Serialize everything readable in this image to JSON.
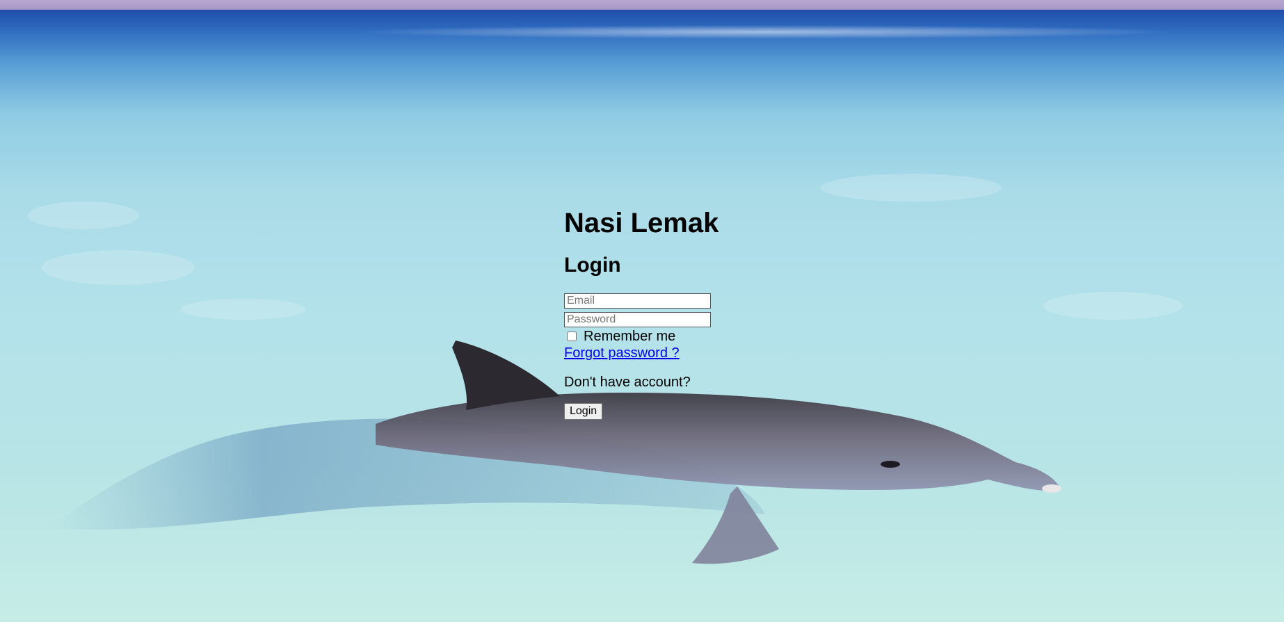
{
  "app": {
    "title": "Nasi Lemak"
  },
  "background": {
    "image": "dolphin-in-sea"
  },
  "login_form": {
    "heading": "Login",
    "email_placeholder": "Email",
    "password_placeholder": "Password",
    "remember_label": "Remember me",
    "remember_checked": false,
    "forgot_link": "Forgot password ?",
    "no_account_text": "Don't have account?",
    "submit_label": "Login"
  },
  "colors": {
    "link": "#0000ee",
    "text": "#000000"
  }
}
